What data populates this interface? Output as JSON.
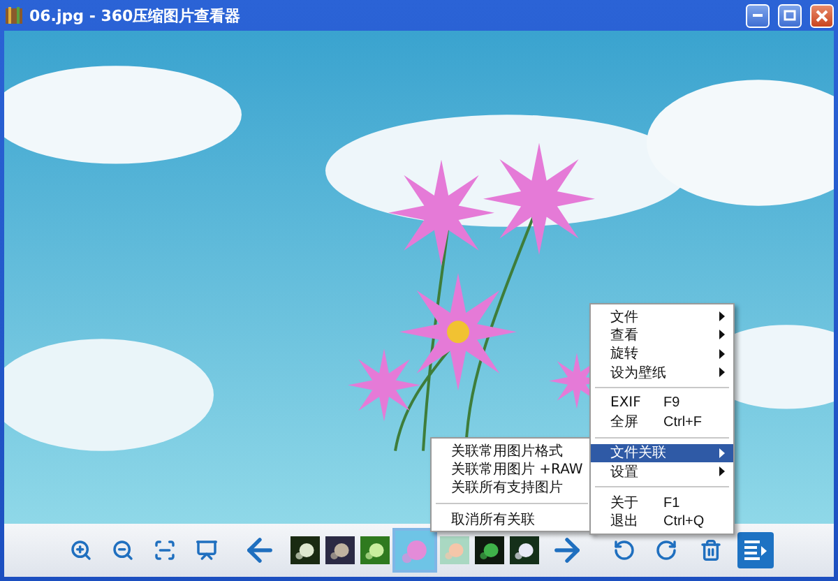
{
  "window": {
    "title": "06.jpg - 360压缩图片查看器"
  },
  "photo": {
    "kind": "picture"
  },
  "context_menu": {
    "items": [
      {
        "kind": "item",
        "label": "文件",
        "submenu": true,
        "selected": false
      },
      {
        "kind": "item",
        "label": "查看",
        "submenu": true,
        "selected": false
      },
      {
        "kind": "item",
        "label": "旋转",
        "submenu": true,
        "selected": false
      },
      {
        "kind": "item",
        "label": "设为壁纸",
        "submenu": true,
        "selected": false
      },
      {
        "kind": "separator"
      },
      {
        "kind": "item",
        "label": "EXIF",
        "shortcut": "F9",
        "submenu": false,
        "selected": false
      },
      {
        "kind": "item",
        "label": "全屏",
        "shortcut": "Ctrl+F",
        "submenu": false,
        "selected": false
      },
      {
        "kind": "separator"
      },
      {
        "kind": "item",
        "label": "文件关联",
        "submenu": true,
        "selected": true
      },
      {
        "kind": "item",
        "label": "设置",
        "submenu": true,
        "selected": false
      },
      {
        "kind": "separator"
      },
      {
        "kind": "item",
        "label": "关于",
        "shortcut": "F1",
        "submenu": false,
        "selected": false
      },
      {
        "kind": "item",
        "label": "退出",
        "shortcut": "Ctrl+Q",
        "submenu": false,
        "selected": false
      }
    ]
  },
  "submenu": {
    "items": [
      {
        "kind": "item",
        "label": "关联常用图片格式",
        "selected": false
      },
      {
        "kind": "item",
        "label": "关联常用图片 +RAW",
        "selected": false
      },
      {
        "kind": "item",
        "label": "关联所有支持图片",
        "selected": false
      },
      {
        "kind": "separator"
      },
      {
        "kind": "item",
        "label": "取消所有关联",
        "selected": false
      }
    ]
  },
  "thumbnails": [
    {
      "kind": "picture",
      "selected": false
    },
    {
      "kind": "picture",
      "selected": false
    },
    {
      "kind": "picture",
      "selected": false
    },
    {
      "kind": "picture",
      "selected": true
    },
    {
      "kind": "picture",
      "selected": false
    },
    {
      "kind": "picture",
      "selected": false
    },
    {
      "kind": "picture",
      "selected": false
    }
  ]
}
